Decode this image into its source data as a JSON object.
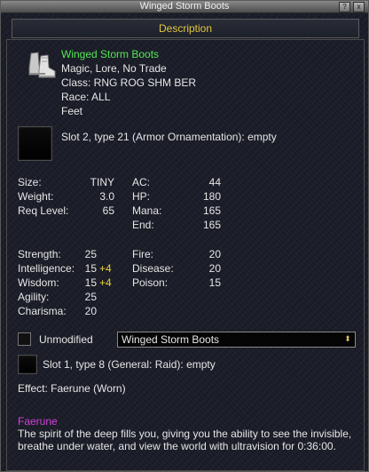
{
  "window": {
    "title": "Winged Storm Boots",
    "help_glyph": "?",
    "close_glyph": "x"
  },
  "header": {
    "label": "Description"
  },
  "item": {
    "icon": "boots-icon",
    "name": "Winged Storm Boots",
    "flags": "Magic, Lore, No Trade",
    "class": "Class: RNG ROG SHM BER",
    "race": "Race: ALL",
    "slot": "Feet"
  },
  "aug_slot_2": {
    "text": "Slot 2, type 21 (Armor Ornamentation): empty"
  },
  "stats": {
    "size_label": "Size:",
    "size_value": "TINY",
    "weight_label": "Weight:",
    "weight_value": "3.0",
    "reqlevel_label": "Req Level:",
    "reqlevel_value": "65",
    "ac_label": "AC:",
    "ac_value": "44",
    "hp_label": "HP:",
    "hp_value": "180",
    "mana_label": "Mana:",
    "mana_value": "165",
    "end_label": "End:",
    "end_value": "165"
  },
  "attributes": [
    {
      "label": "Strength:",
      "value": "25",
      "mod": ""
    },
    {
      "label": "Intelligence:",
      "value": "15",
      "mod": "+4"
    },
    {
      "label": "Wisdom:",
      "value": "15",
      "mod": "+4"
    },
    {
      "label": "Agility:",
      "value": "25",
      "mod": ""
    },
    {
      "label": "Charisma:",
      "value": "20",
      "mod": ""
    }
  ],
  "resists": [
    {
      "label": "Fire:",
      "value": "20"
    },
    {
      "label": "Disease:",
      "value": "20"
    },
    {
      "label": "Poison:",
      "value": "15"
    }
  ],
  "unmodified": {
    "label": "Unmodified",
    "checked": false
  },
  "dropdown": {
    "selected": "Winged Storm Boots",
    "arrow_icon": "updown-arrow-icon"
  },
  "aug_slot_1": {
    "text": "Slot 1, type 8 (General: Raid): empty"
  },
  "effect": {
    "text": "Effect: Faerune (Worn)"
  },
  "spell": {
    "name": "Faerune",
    "description": "The spirit of the deep fills you, giving you the ability to see the invisible, breathe under water, and view the world with ultravision for 0:36:00."
  },
  "colors": {
    "item_name": "#54e654",
    "header_text": "#e2c640",
    "stat_modifier": "#e8d23e",
    "spell_name": "#d040d8"
  }
}
